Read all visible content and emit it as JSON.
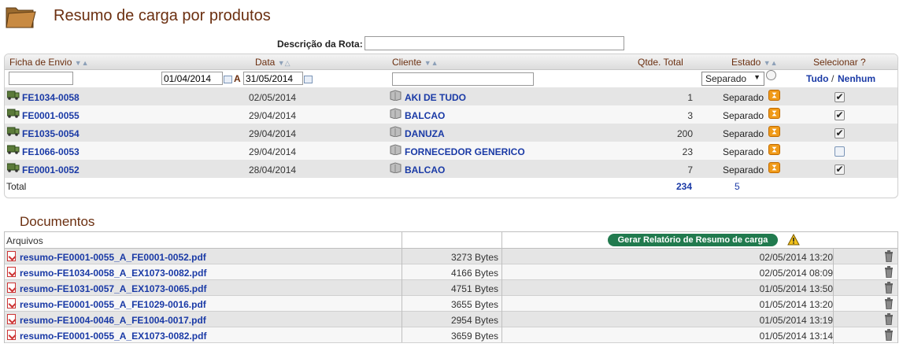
{
  "page": {
    "title": "Resumo de carga por produtos"
  },
  "route": {
    "label": "Descrição da Rota:",
    "value": ""
  },
  "grid": {
    "columns": {
      "ficha": "Ficha de Envio",
      "data": "Data",
      "cliente": "Cliente",
      "qtde": "Qtde. Total",
      "estado": "Estado",
      "selecionar": "Selecionar ?"
    },
    "filters": {
      "ficha": "",
      "date_from": "01/04/2014",
      "date_sep": "A",
      "date_to": "31/05/2014",
      "cliente": "",
      "estado": "Separado",
      "select_all": "Tudo",
      "select_sep": "/",
      "select_none": "Nenhum"
    },
    "rows": [
      {
        "ficha": "FE1034-0058",
        "data": "02/05/2014",
        "cliente": "AKI DE TUDO",
        "qtde": "1",
        "estado": "Separado",
        "checked": true
      },
      {
        "ficha": "FE0001-0055",
        "data": "29/04/2014",
        "cliente": "BALCAO",
        "qtde": "3",
        "estado": "Separado",
        "checked": true
      },
      {
        "ficha": "FE1035-0054",
        "data": "29/04/2014",
        "cliente": "DANUZA",
        "qtde": "200",
        "estado": "Separado",
        "checked": true
      },
      {
        "ficha": "FE1066-0053",
        "data": "29/04/2014",
        "cliente": "FORNECEDOR GENERICO",
        "qtde": "23",
        "estado": "Separado",
        "checked": false
      },
      {
        "ficha": "FE0001-0052",
        "data": "28/04/2014",
        "cliente": "BALCAO",
        "qtde": "7",
        "estado": "Separado",
        "checked": true
      }
    ],
    "total": {
      "label": "Total",
      "qtde": "234",
      "count": "5"
    }
  },
  "documents": {
    "title": "Documentos",
    "header": "Arquivos",
    "generate_button": "Gerar Relatório de Resumo de carga",
    "files": [
      {
        "name": "resumo-FE0001-0055_A_FE0001-0052.pdf",
        "size": "3273 Bytes",
        "date": "02/05/2014 13:20"
      },
      {
        "name": "resumo-FE1034-0058_A_EX1073-0082.pdf",
        "size": "4166 Bytes",
        "date": "02/05/2014 08:09"
      },
      {
        "name": "resumo-FE1031-0057_A_EX1073-0065.pdf",
        "size": "4751 Bytes",
        "date": "01/05/2014 13:50"
      },
      {
        "name": "resumo-FE0001-0055_A_FE1029-0016.pdf",
        "size": "3655 Bytes",
        "date": "01/05/2014 13:20"
      },
      {
        "name": "resumo-FE1004-0046_A_FE1004-0017.pdf",
        "size": "2954 Bytes",
        "date": "01/05/2014 13:19"
      },
      {
        "name": "resumo-FE0001-0055_A_EX1073-0082.pdf",
        "size": "3659 Bytes",
        "date": "01/05/2014 13:14"
      }
    ]
  },
  "icons": {
    "folder": "folder-icon",
    "calendar": "calendar-icon",
    "truck": "truck-icon",
    "client": "box-icon",
    "state": "hourglass-icon",
    "pdf": "pdf-icon",
    "delete": "trash-icon",
    "warning": "warning-icon"
  },
  "colors": {
    "title": "#6b2f10",
    "link": "#1a3aa6",
    "button": "#217a4e",
    "state_icon": "#f09a18"
  }
}
